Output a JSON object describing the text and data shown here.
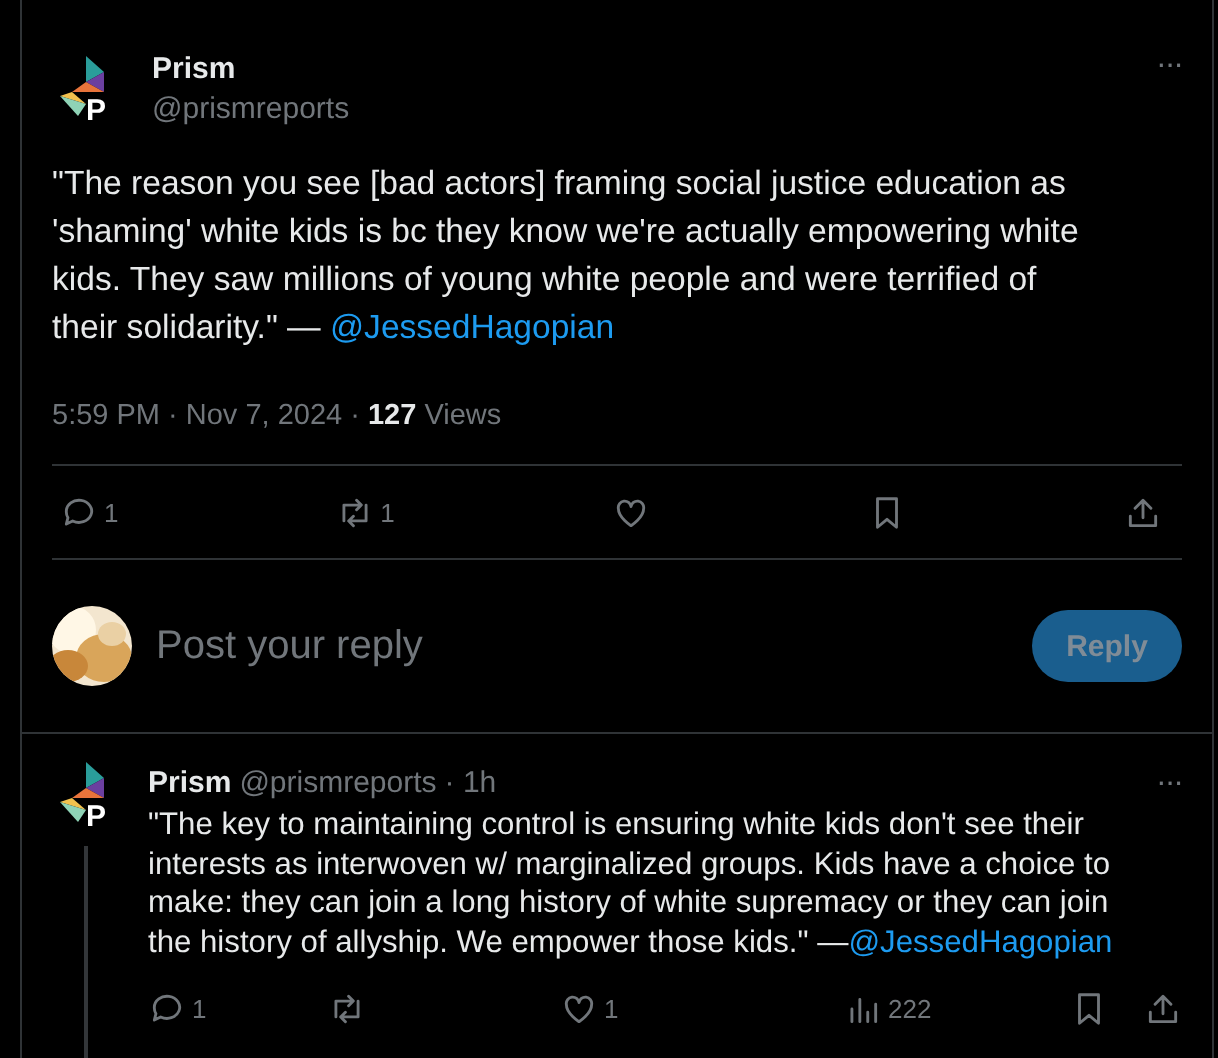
{
  "main_post": {
    "author": {
      "name": "Prism",
      "handle": "@prismreports",
      "logo_letter": "P"
    },
    "more": "···",
    "text": "\"The reason you see [bad actors] framing social justice education as 'shaming' white kids is bc they know we're actually empowering white kids. They saw millions of young white people and were terrified of their solidarity.\" — ",
    "mention": "@JessedHagopian",
    "meta": "5:59 PM · Nov 7, 2024 · **127** Views",
    "actions": [
      {
        "kind": "reply",
        "count": "1"
      },
      {
        "kind": "repost",
        "count": "1"
      },
      {
        "kind": "like"
      },
      {
        "kind": "bookmark"
      },
      {
        "kind": "share"
      }
    ]
  },
  "reply_box": {
    "placeholder": "Post your reply",
    "button": "Reply"
  },
  "reply_post": {
    "author": {
      "name": "Prism",
      "handle": "@prismreports",
      "logo_letter": "P"
    },
    "time": "· 1h",
    "more": "···",
    "text": "\"The key to maintaining control is ensuring white kids don't see their interests as interwoven w/ marginalized groups. Kids have a choice to make: they can join a long history of white supremacy or they can join the history of allyship. We empower those kids.\" —",
    "mention": "@JessedHagopian",
    "actions": [
      {
        "kind": "reply",
        "count": "1"
      },
      {
        "kind": "repost"
      },
      {
        "kind": "like",
        "count": "1"
      },
      {
        "kind": "views",
        "count": "222"
      },
      {
        "kind": "bookmark"
      },
      {
        "kind": "share"
      }
    ]
  }
}
